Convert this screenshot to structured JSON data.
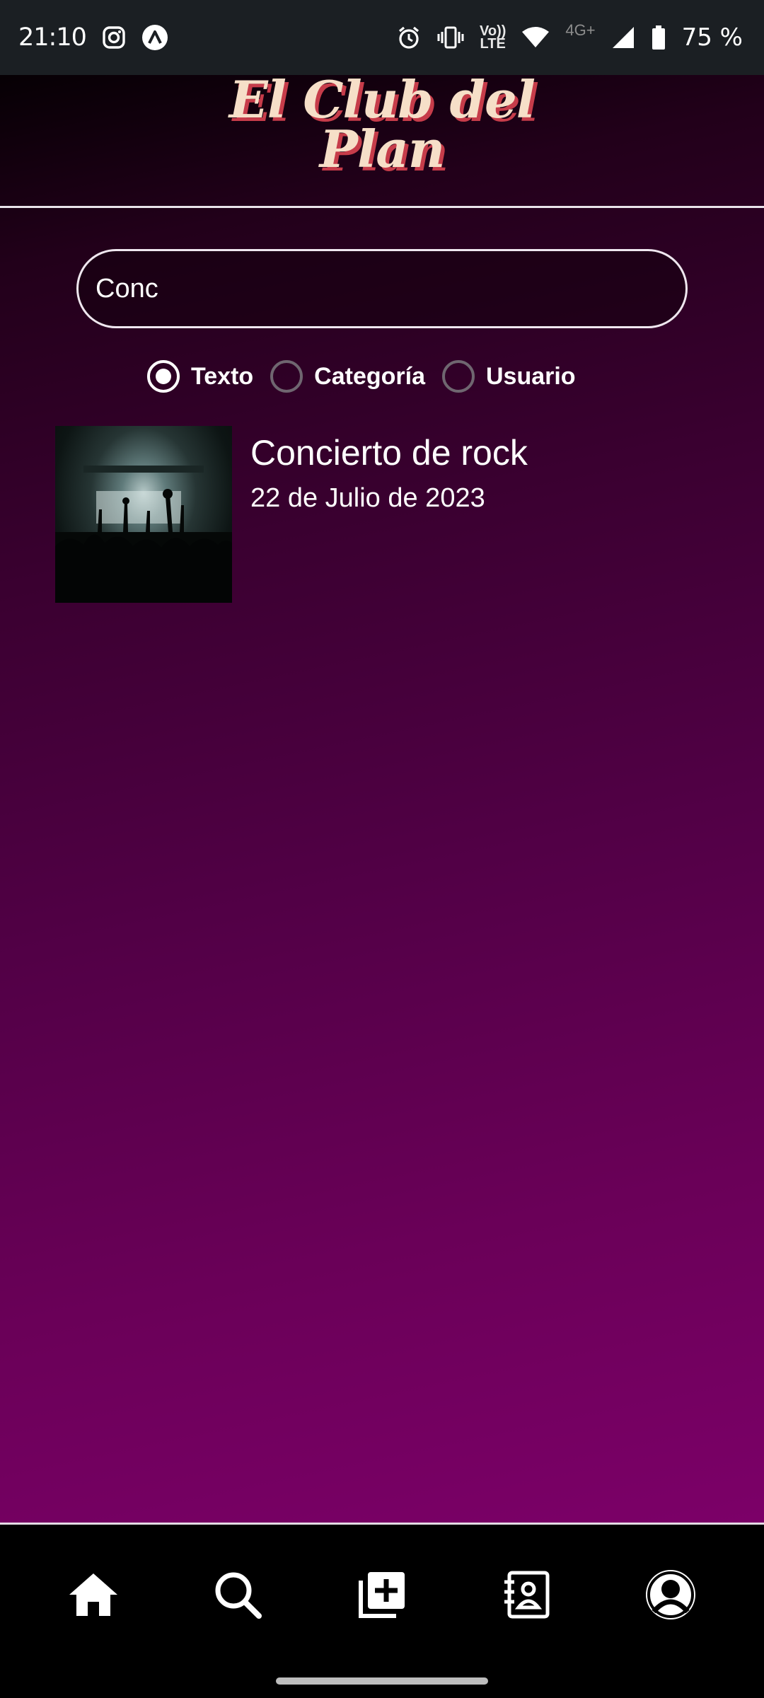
{
  "status_bar": {
    "time": "21:10",
    "icons_left": [
      "instagram-icon",
      "app-notification-icon"
    ],
    "icons_right": [
      "alarm-icon",
      "vibrate-icon",
      "volte-icon",
      "wifi-icon",
      "signal-icon",
      "battery-icon"
    ],
    "volte_top": "Vo))",
    "volte_bottom": "LTE",
    "network": "4G+",
    "battery": "75 %"
  },
  "header": {
    "logo_line1": "El Club del",
    "logo_line2": "Plan"
  },
  "search": {
    "value": "Conc"
  },
  "filters": {
    "selected": "Texto",
    "options": [
      {
        "label": "Texto",
        "checked": true
      },
      {
        "label": "Categoría",
        "checked": false
      },
      {
        "label": "Usuario",
        "checked": false
      }
    ]
  },
  "results": [
    {
      "title": "Concierto de rock",
      "date": "22 de Julio de 2023",
      "image": "concert-crowd-photo"
    }
  ],
  "bottom_nav": {
    "items": [
      "home-icon",
      "search-icon",
      "add-plan-icon",
      "contacts-icon",
      "profile-icon"
    ]
  },
  "colors": {
    "bg_top": "#060004",
    "bg_bottom": "#7c0068",
    "logo_fill": "#f6dfc8",
    "logo_shadow": "#c63c4a",
    "status_bar": "#1b1f23"
  }
}
